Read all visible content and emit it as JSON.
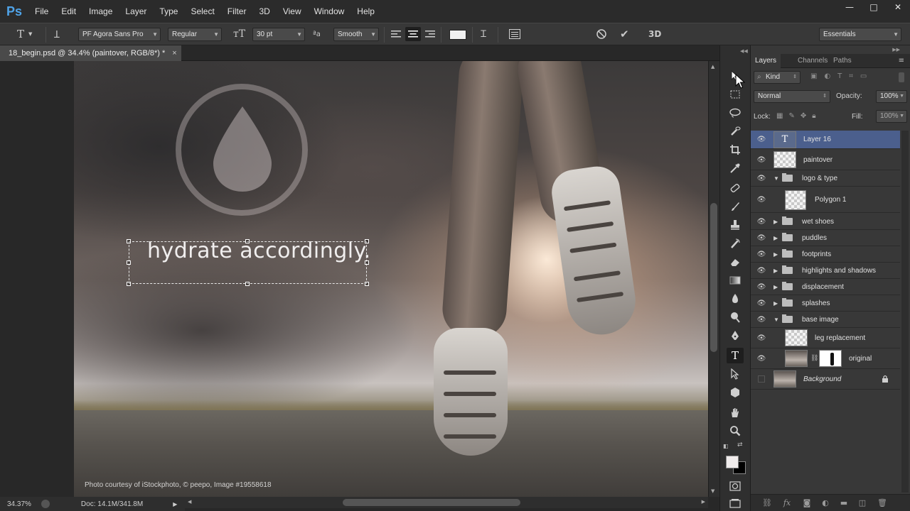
{
  "app": {
    "logo": "Ps"
  },
  "menu": [
    "File",
    "Edit",
    "Image",
    "Layer",
    "Type",
    "Select",
    "Filter",
    "3D",
    "View",
    "Window",
    "Help"
  ],
  "window_controls": {
    "minimize": "—",
    "maximize": "□",
    "close": "✕"
  },
  "options": {
    "font_family": "PF Agora Sans Pro",
    "font_style": "Regular",
    "font_size": "30 pt",
    "antialias_icon": "ªa",
    "antialias": "Smooth",
    "workspace": "Essentials",
    "text_color": "#f0f0f0"
  },
  "document": {
    "tab_title": "18_begin.psd @ 34.4% (paintover, RGB/8*) *",
    "close": "×",
    "headline": "hydrate accordingly.",
    "credit": "Photo courtesy of iStockphoto, © peepo, Image #19558618"
  },
  "status": {
    "zoom": "34.37%",
    "doc": "Doc: 14.1M/341.8M"
  },
  "panel": {
    "tabs": [
      "Layers",
      "Channels",
      "Paths"
    ],
    "filter_kind": "Kind",
    "blend_mode": "Normal",
    "opacity_label": "Opacity:",
    "opacity": "100%",
    "lock_label": "Lock:",
    "fill_label": "Fill:",
    "fill": "100%",
    "layers": [
      {
        "name": "Layer 16",
        "type": "text",
        "selected": true
      },
      {
        "name": "paintover",
        "type": "pixel"
      },
      {
        "name": "logo & type",
        "type": "group",
        "open": true
      },
      {
        "name": "Polygon 1",
        "type": "shape"
      },
      {
        "name": "wet shoes",
        "type": "group"
      },
      {
        "name": "puddles",
        "type": "group"
      },
      {
        "name": "footprints",
        "type": "group"
      },
      {
        "name": "highlights and shadows",
        "type": "group"
      },
      {
        "name": "displacement",
        "type": "group"
      },
      {
        "name": "splashes",
        "type": "group"
      },
      {
        "name": "base image",
        "type": "group",
        "open": true
      },
      {
        "name": "leg replacement",
        "type": "pixel"
      },
      {
        "name": "original",
        "type": "masked"
      },
      {
        "name": "Background",
        "type": "background",
        "locked": true
      }
    ]
  }
}
